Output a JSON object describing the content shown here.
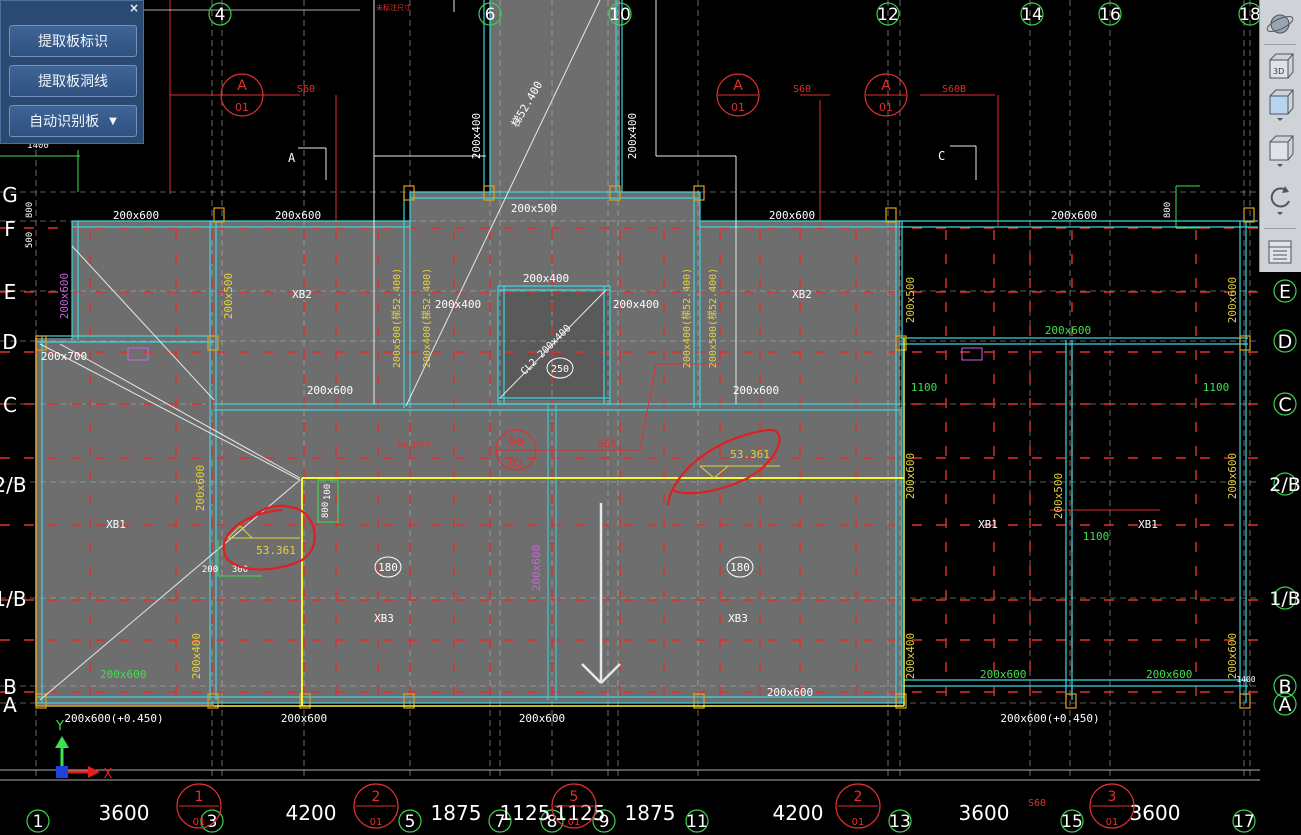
{
  "panel": {
    "buttons": [
      "提取板标识",
      "提取板洞线",
      "自动识别板"
    ],
    "close": "×"
  },
  "toolbar": {
    "icons": [
      "orbit-icon",
      "view-3d-icon",
      "view-box-icon",
      "view-cube-icon",
      "rotate-icon",
      "grid-panel-icon"
    ],
    "label_3d": "3D"
  },
  "axes": {
    "top": [
      "4",
      "6",
      "10",
      "12",
      "14",
      "16",
      "18"
    ],
    "bottom": [
      "1",
      "3",
      "5",
      "7",
      "8",
      "9",
      "11",
      "13",
      "15",
      "17"
    ],
    "left": [
      "G",
      "F",
      "E",
      "D",
      "C",
      "2/B",
      "1/B",
      "B",
      "A"
    ],
    "right": [
      "E",
      "D",
      "C",
      "2/B",
      "1/B",
      "B",
      "A"
    ]
  },
  "dimensions": [
    "3600",
    "4200",
    "1875",
    "1125",
    "1125",
    "1875",
    "4200",
    "3600",
    "3600"
  ],
  "slabs": {
    "XB1": "XB1",
    "XB2": "XB2",
    "XB3": "XB3",
    "thickness": "180",
    "elev": "53.361",
    "fillet": "250"
  },
  "beams": {
    "b200x600": "200x600",
    "b200x500": "200x500",
    "b200x400": "200x400",
    "b200x700": "200x700",
    "b200x600_045": "200x600(+0.450)",
    "b200x500_step": "200x500(梯52.400)",
    "b200x400_step": "200x400(梯52.400)",
    "stair_tag": "梯52.400",
    "cl_tag": "CL2 200x400",
    "num_1100": "1100",
    "num_800": "800",
    "num_500": "500",
    "num_300": "300",
    "num_100": "100",
    "num_200": "200",
    "num_1400": "1400"
  },
  "labels": {
    "A": "A",
    "C": "C",
    "s60": "S60",
    "s60b": "S60B",
    "circle_a": "A",
    "circle_01": "01",
    "circle_6a": "6a",
    "circle_02": "02",
    "bubble_1": "1",
    "bubble_2": "2",
    "bubble_3": "3",
    "bubble_5": "5",
    "note": "未标注尺寸"
  },
  "ucs": {
    "y": "Y",
    "x": "X"
  }
}
